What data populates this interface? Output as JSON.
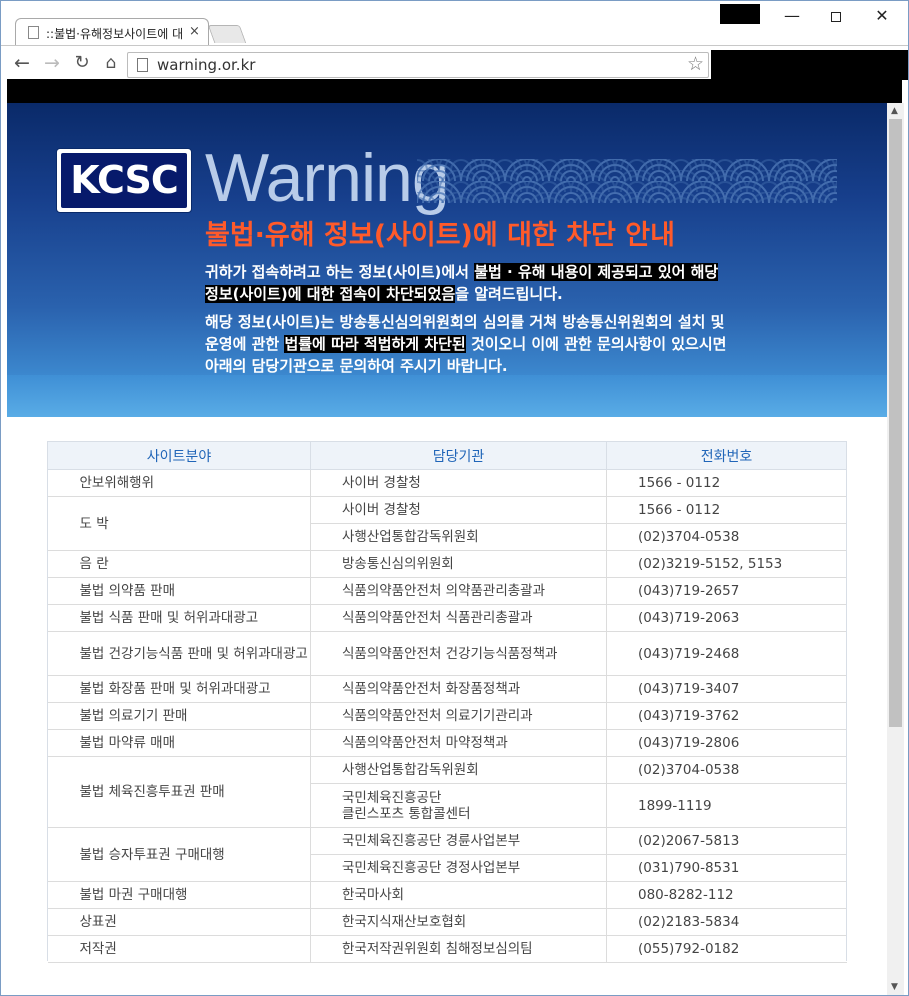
{
  "browser": {
    "tab_title": "::불법·유해정보사이트에 대",
    "tab_close": "×",
    "url": "warning.or.kr",
    "window_min": "—",
    "window_close": "✕"
  },
  "banner": {
    "logo_text": "KCSC",
    "warning_word": "Warning",
    "headline": "불법·유해 정보(사이트)에 대한 차단 안내",
    "para1_line1_a": "귀하가 접속하려고 하는 정보(사이트)에서 ",
    "para1_line1_b": "불법 · 유해 내용이 제공되고 있어 해당",
    "para1_line2_a": "정보(사이트)에 대한 접속이 차단되었음",
    "para1_line2_b": "을 알려드립니다.",
    "para2_line1": "해당 정보(사이트)는 방송통신심의위원회의 심의를 거쳐 방송통신위원회의 설치 및",
    "para2_line2_a": "운영에 관한 ",
    "para2_line2_b": "법률에 따라 적법하게 차단된",
    "para2_line2_c": " 것이오니 이에 관한 문의사항이 있으시면",
    "para2_line3": "아래의 담당기관으로  문의하여 주시기 바랍니다."
  },
  "table": {
    "headers": [
      "사이트분야",
      "담당기관",
      "전화번호"
    ],
    "rows": [
      {
        "field": "안보위해행위",
        "agency": "사이버 경찰청",
        "phone": "1566 - 0112"
      },
      {
        "field": "도 박",
        "agency": "사이버 경찰청",
        "phone": "1566 - 0112"
      },
      {
        "field": "",
        "agency": "사행산업통합감독위원회",
        "phone": "(02)3704-0538"
      },
      {
        "field": "음 란",
        "agency": "방송통신심의위원회",
        "phone": "(02)3219-5152, 5153"
      },
      {
        "field": "불법 의약품 판매",
        "agency": "식품의약품안전처 의약품관리총괄과",
        "phone": "(043)719-2657"
      },
      {
        "field": "불법 식품 판매 및 허위과대광고",
        "agency": "식품의약품안전처 식품관리총괄과",
        "phone": "(043)719-2063"
      },
      {
        "field": "불법 건강기능식품 판매 및 허위과대광고",
        "agency": "식품의약품안전처 건강기능식품정책과",
        "phone": "(043)719-2468"
      },
      {
        "field": "불법 화장품 판매 및 허위과대광고",
        "agency": "식품의약품안전처 화장품정책과",
        "phone": "(043)719-3407"
      },
      {
        "field": "불법 의료기기 판매",
        "agency": "식품의약품안전처 의료기기관리과",
        "phone": "(043)719-3762"
      },
      {
        "field": "불법 마약류 매매",
        "agency": "식품의약품안전처 마약정책과",
        "phone": "(043)719-2806"
      },
      {
        "field": "불법 체육진흥투표권 판매",
        "agency": "사행산업통합감독위원회",
        "phone": "(02)3704-0538"
      },
      {
        "field": "",
        "agency": "국민체육진흥공단\n클린스포츠 통합콜센터",
        "phone": "1899-1119"
      },
      {
        "field": "불법 승자투표권 구매대행",
        "agency": "국민체육진흥공단 경륜사업본부",
        "phone": "(02)2067-5813"
      },
      {
        "field": "",
        "agency": "국민체육진흥공단 경정사업본부",
        "phone": "(031)790-8531"
      },
      {
        "field": "불법 마권 구매대행",
        "agency": "한국마사회",
        "phone": "080-8282-112"
      },
      {
        "field": "상표권",
        "agency": "한국지식재산보호협회",
        "phone": "(02)2183-5834"
      },
      {
        "field": "저작권",
        "agency": "한국저작권위원회 침해정보심의팀",
        "phone": "(055)792-0182"
      }
    ]
  }
}
